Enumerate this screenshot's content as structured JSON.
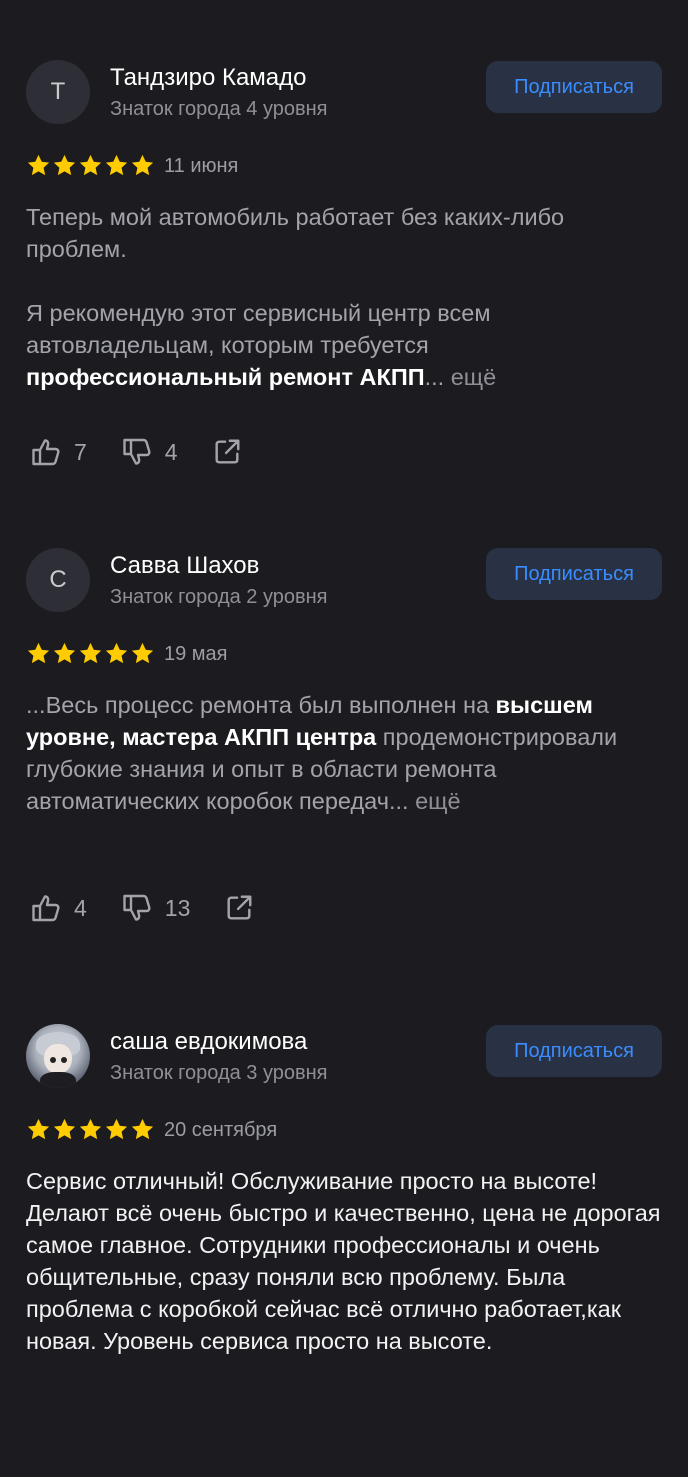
{
  "reviews": [
    {
      "avatar_letter": "Т",
      "avatar_type": "letter",
      "name": "Тандзиро Камадо",
      "level": "Знаток города 4 уровня",
      "subscribe_label": "Подписаться",
      "rating": 5,
      "date": "11 июня",
      "text_part1": "Теперь мой автомобиль работает без каких-либо проблем.",
      "text_part2": "Я рекомендую этот сервисный центр всем автовладельцам, которым требуется ",
      "text_bold": "профессиональный ремонт АКПП",
      "text_end": "...",
      "more_label": " ещё",
      "likes": "7",
      "dislikes": "4"
    },
    {
      "avatar_letter": "С",
      "avatar_type": "letter",
      "name": "Савва Шахов",
      "level": "Знаток города 2 уровня",
      "subscribe_label": "Подписаться",
      "rating": 5,
      "date": "19 мая",
      "text_start": "...Весь процесс ремонта был выполнен на ",
      "text_bold": "высшем уровне, мастера АКПП центра",
      "text_rest": " продемонстрировали глубокие знания и опыт в области ремонта автоматических коробок передач...",
      "more_label": " ещё",
      "likes": "4",
      "dislikes": "13"
    },
    {
      "avatar_type": "image",
      "avatar_icon": "anime-girl-avatar",
      "name": "саша евдокимова",
      "level": "Знаток города 3 уровня",
      "subscribe_label": "Подписаться",
      "rating": 5,
      "date": "20 сентября",
      "text": "Сервис отличный! Обслуживание просто на высоте! Делают всё очень быстро и качественно, цена не дорогая самое главное. Сотрудники профессионалы и очень общительные, сразу поняли всю проблему. Была проблема с коробкой сейчас всё отлично работает,как новая. Уровень сервиса просто на высоте."
    }
  ],
  "colors": {
    "background": "#1c1c20",
    "star": "#ffcc00",
    "subscribe_text": "#3a8dff",
    "subscribe_bg": "#283244"
  }
}
